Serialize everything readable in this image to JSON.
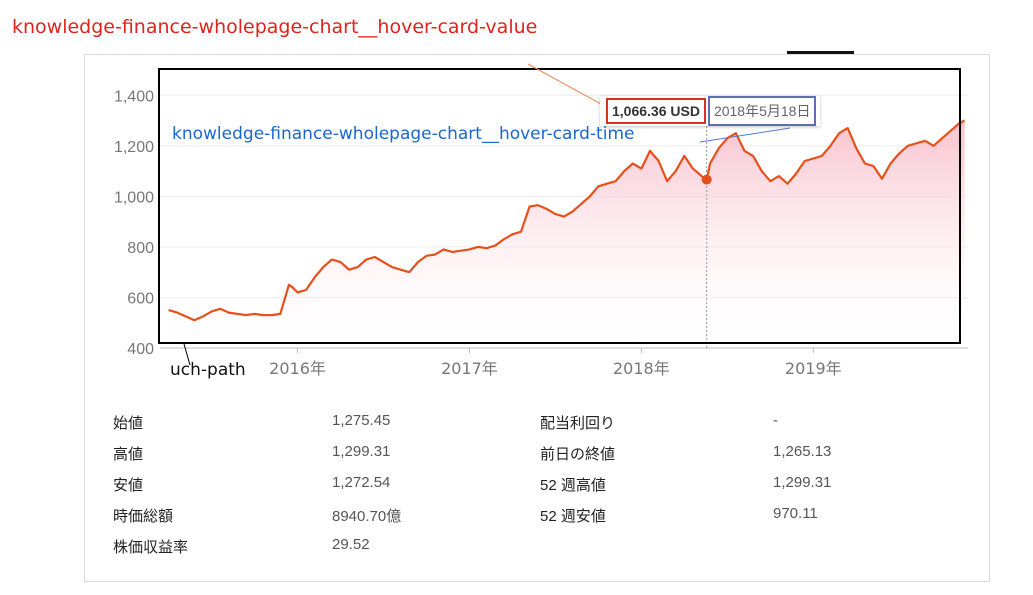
{
  "annotations": {
    "hover_value_label": "knowledge-finance-wholepage-chart__hover-card-value",
    "hover_time_label": "knowledge-finance-wholepage-chart__hover-card-time",
    "path_label": "uch-path"
  },
  "hover_card": {
    "value": "1,066.36 USD",
    "time": "2018年5月18日"
  },
  "colors": {
    "line": "#e8501a",
    "fill_top": "#f7b6c4",
    "grid": "#eeeeee",
    "axis_text": "#777777"
  },
  "chart_data": {
    "type": "area",
    "y_ticks": [
      "1,400",
      "1,200",
      "1,000",
      "800",
      "600",
      "400"
    ],
    "x_ticks": [
      "2016年",
      "2017年",
      "2018年",
      "2019年"
    ],
    "ylim": [
      400,
      1500
    ],
    "xlim": [
      2015.2,
      2019.9
    ],
    "x": [
      2015.25,
      2015.3,
      2015.35,
      2015.4,
      2015.45,
      2015.5,
      2015.55,
      2015.6,
      2015.65,
      2015.7,
      2015.75,
      2015.8,
      2015.85,
      2015.9,
      2015.95,
      2015.97,
      2016.0,
      2016.05,
      2016.1,
      2016.15,
      2016.2,
      2016.25,
      2016.3,
      2016.35,
      2016.4,
      2016.45,
      2016.5,
      2016.55,
      2016.6,
      2016.65,
      2016.7,
      2016.75,
      2016.8,
      2016.85,
      2016.9,
      2016.95,
      2017.0,
      2017.05,
      2017.1,
      2017.15,
      2017.2,
      2017.25,
      2017.3,
      2017.35,
      2017.4,
      2017.45,
      2017.5,
      2017.55,
      2017.6,
      2017.65,
      2017.7,
      2017.75,
      2017.8,
      2017.85,
      2017.9,
      2017.95,
      2018.0,
      2018.05,
      2018.1,
      2018.15,
      2018.2,
      2018.25,
      2018.3,
      2018.35,
      2018.38,
      2018.4,
      2018.45,
      2018.5,
      2018.55,
      2018.6,
      2018.65,
      2018.7,
      2018.75,
      2018.8,
      2018.85,
      2018.9,
      2018.95,
      2019.0,
      2019.05,
      2019.1,
      2019.15,
      2019.2,
      2019.25,
      2019.3,
      2019.35,
      2019.4,
      2019.45,
      2019.5,
      2019.55,
      2019.6,
      2019.65,
      2019.7,
      2019.75,
      2019.8,
      2019.85,
      2019.88
    ],
    "values": [
      550,
      540,
      525,
      510,
      525,
      545,
      555,
      540,
      535,
      530,
      535,
      530,
      530,
      535,
      650,
      640,
      620,
      630,
      680,
      720,
      750,
      740,
      710,
      720,
      750,
      760,
      740,
      720,
      710,
      700,
      740,
      765,
      770,
      790,
      780,
      785,
      790,
      800,
      795,
      805,
      830,
      850,
      860,
      960,
      965,
      950,
      930,
      920,
      940,
      970,
      1000,
      1040,
      1050,
      1060,
      1100,
      1130,
      1110,
      1180,
      1140,
      1060,
      1100,
      1160,
      1110,
      1080,
      1066,
      1130,
      1190,
      1230,
      1250,
      1180,
      1160,
      1100,
      1060,
      1080,
      1050,
      1090,
      1140,
      1150,
      1160,
      1200,
      1250,
      1270,
      1190,
      1130,
      1120,
      1070,
      1130,
      1170,
      1200,
      1210,
      1220,
      1200,
      1230,
      1260,
      1290,
      1300
    ],
    "hover_point": {
      "x": 2018.38,
      "y": 1066.36
    }
  },
  "stats": {
    "left": [
      {
        "label": "始値",
        "value": "1,275.45"
      },
      {
        "label": "高値",
        "value": "1,299.31"
      },
      {
        "label": "安値",
        "value": "1,272.54"
      },
      {
        "label": "時価総額",
        "value": "8940.70億"
      },
      {
        "label": "株価収益率",
        "value": "29.52"
      }
    ],
    "right": [
      {
        "label": "配当利回り",
        "value": "-"
      },
      {
        "label": "前日の終値",
        "value": "1,265.13"
      },
      {
        "label": "52 週高値",
        "value": "1,299.31"
      },
      {
        "label": "52 週安値",
        "value": "970.11"
      }
    ]
  }
}
